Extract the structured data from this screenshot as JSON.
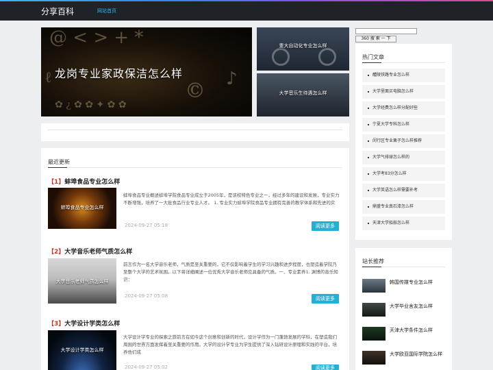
{
  "header": {
    "brand": "分享百科",
    "nav_home": "网站首页"
  },
  "slider": {
    "main_caption": "龙岗专业家政保洁怎么样",
    "side": [
      {
        "caption": "重大自动化专业怎么样"
      },
      {
        "caption": "大学音乐生待遇怎么样"
      }
    ]
  },
  "search": {
    "value": "",
    "button_label": "360 搜 索 一 下"
  },
  "recent": {
    "title": "最近更新",
    "more_label": "阅读更多",
    "articles": [
      {
        "num": "【1】",
        "title": "蚌埠食品专业怎么样",
        "thumb_caption": "蚌埠食品专业怎么样",
        "excerpt": "蚌埠食品专业概述蚌埠学院食品专业成立于2005年，是该校特色专业之一，经过多年的建设和发展，专业实力不断增强，培养了一大批食品行业专业人才。 1. 专业实力蚌埠学院食品专业拥有完善的教学体系和先进的实",
        "date": "2024-09-27 05:18"
      },
      {
        "num": "【2】",
        "title": "大学音乐老师气质怎么样",
        "thumb_caption": "大学音乐老师气质怎么样",
        "excerpt": "前言作为一名大学音乐老师，气质是至关重要的，它不仅影响着学生的学习兴趣和进步程度，也塑造着学院乃至整个大学的艺术氛围。以下将详细阐述一位优秀大学音乐老师应具备的气质。一、专业素养1. 渊博的音乐知识：",
        "date": "2024-09-27 05:08"
      },
      {
        "num": "【3】",
        "title": "大学设计学类怎么样",
        "thumb_caption": "大学设计学类怎么样",
        "excerpt": "大学设计学专业的探索之旅前言在如今这个创意和创新的时代，设计学作为一门蓬勃发展的学科，在塑造我们周围的世界方面发挥着至关重要的作用。大学的设计学专业为学生提供了深入钻研设计原理和实践的平台，培养他们成",
        "date": "2024-09-27 05:02"
      }
    ]
  },
  "hot": {
    "title": "热门文章",
    "items": [
      "醴陵铁路专业怎么样",
      "大学里面买电脑怎么样",
      "大学经费怎么样分配好些",
      "宁夏大学专科怎么样",
      "闵行区专业栗子怎么样推荐",
      "大学气排球怎么样的",
      "大学考83分怎么样",
      "大学英语怎么样需要补考",
      "鼎盛专业真石漆怎么样",
      "天津大学船舶怎么样"
    ]
  },
  "recommend": {
    "title": "站长推荐",
    "items": [
      "韩国传媒专业怎么样",
      "大学毕业舍友怎么样",
      "天津大学条件怎么样",
      "大学欧亚国际学院怎么样"
    ]
  },
  "colors": {
    "accent": "#22b0d5",
    "topbar": "#1f2327",
    "number_red": "#c0392b"
  }
}
